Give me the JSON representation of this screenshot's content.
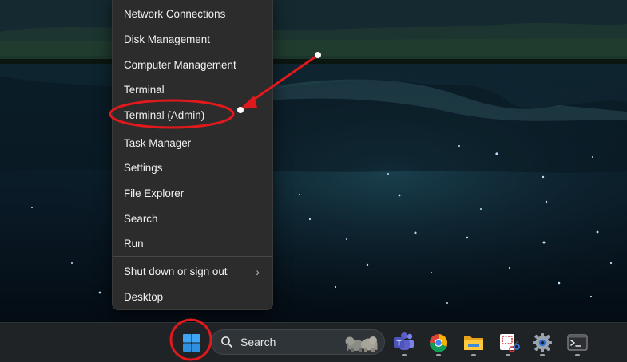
{
  "menu": {
    "items": [
      {
        "label": "Network Connections"
      },
      {
        "label": "Disk Management"
      },
      {
        "label": "Computer Management"
      },
      {
        "label": "Terminal"
      },
      {
        "label": "Terminal (Admin)"
      },
      {
        "label": "Task Manager"
      },
      {
        "label": "Settings"
      },
      {
        "label": "File Explorer"
      },
      {
        "label": "Search"
      },
      {
        "label": "Run"
      },
      {
        "label": "Shut down or sign out",
        "has_submenu": true,
        "submenu_icon": "chevron-right-icon"
      },
      {
        "label": "Desktop"
      }
    ]
  },
  "taskbar": {
    "search_label": "Search",
    "apps": [
      {
        "name": "teams",
        "icon": "teams-icon"
      },
      {
        "name": "chrome",
        "icon": "chrome-icon"
      },
      {
        "name": "file-explorer",
        "icon": "folder-icon"
      },
      {
        "name": "snipping-tool",
        "icon": "snipping-tool-icon"
      },
      {
        "name": "settings",
        "icon": "gear-icon"
      },
      {
        "name": "terminal",
        "icon": "terminal-icon"
      }
    ]
  },
  "colors": {
    "annotation": "#e0191d",
    "menu_bg": "#2c2c2c",
    "taskbar_bg": "#1f2326",
    "windows_blue": "#3ea6f2"
  }
}
